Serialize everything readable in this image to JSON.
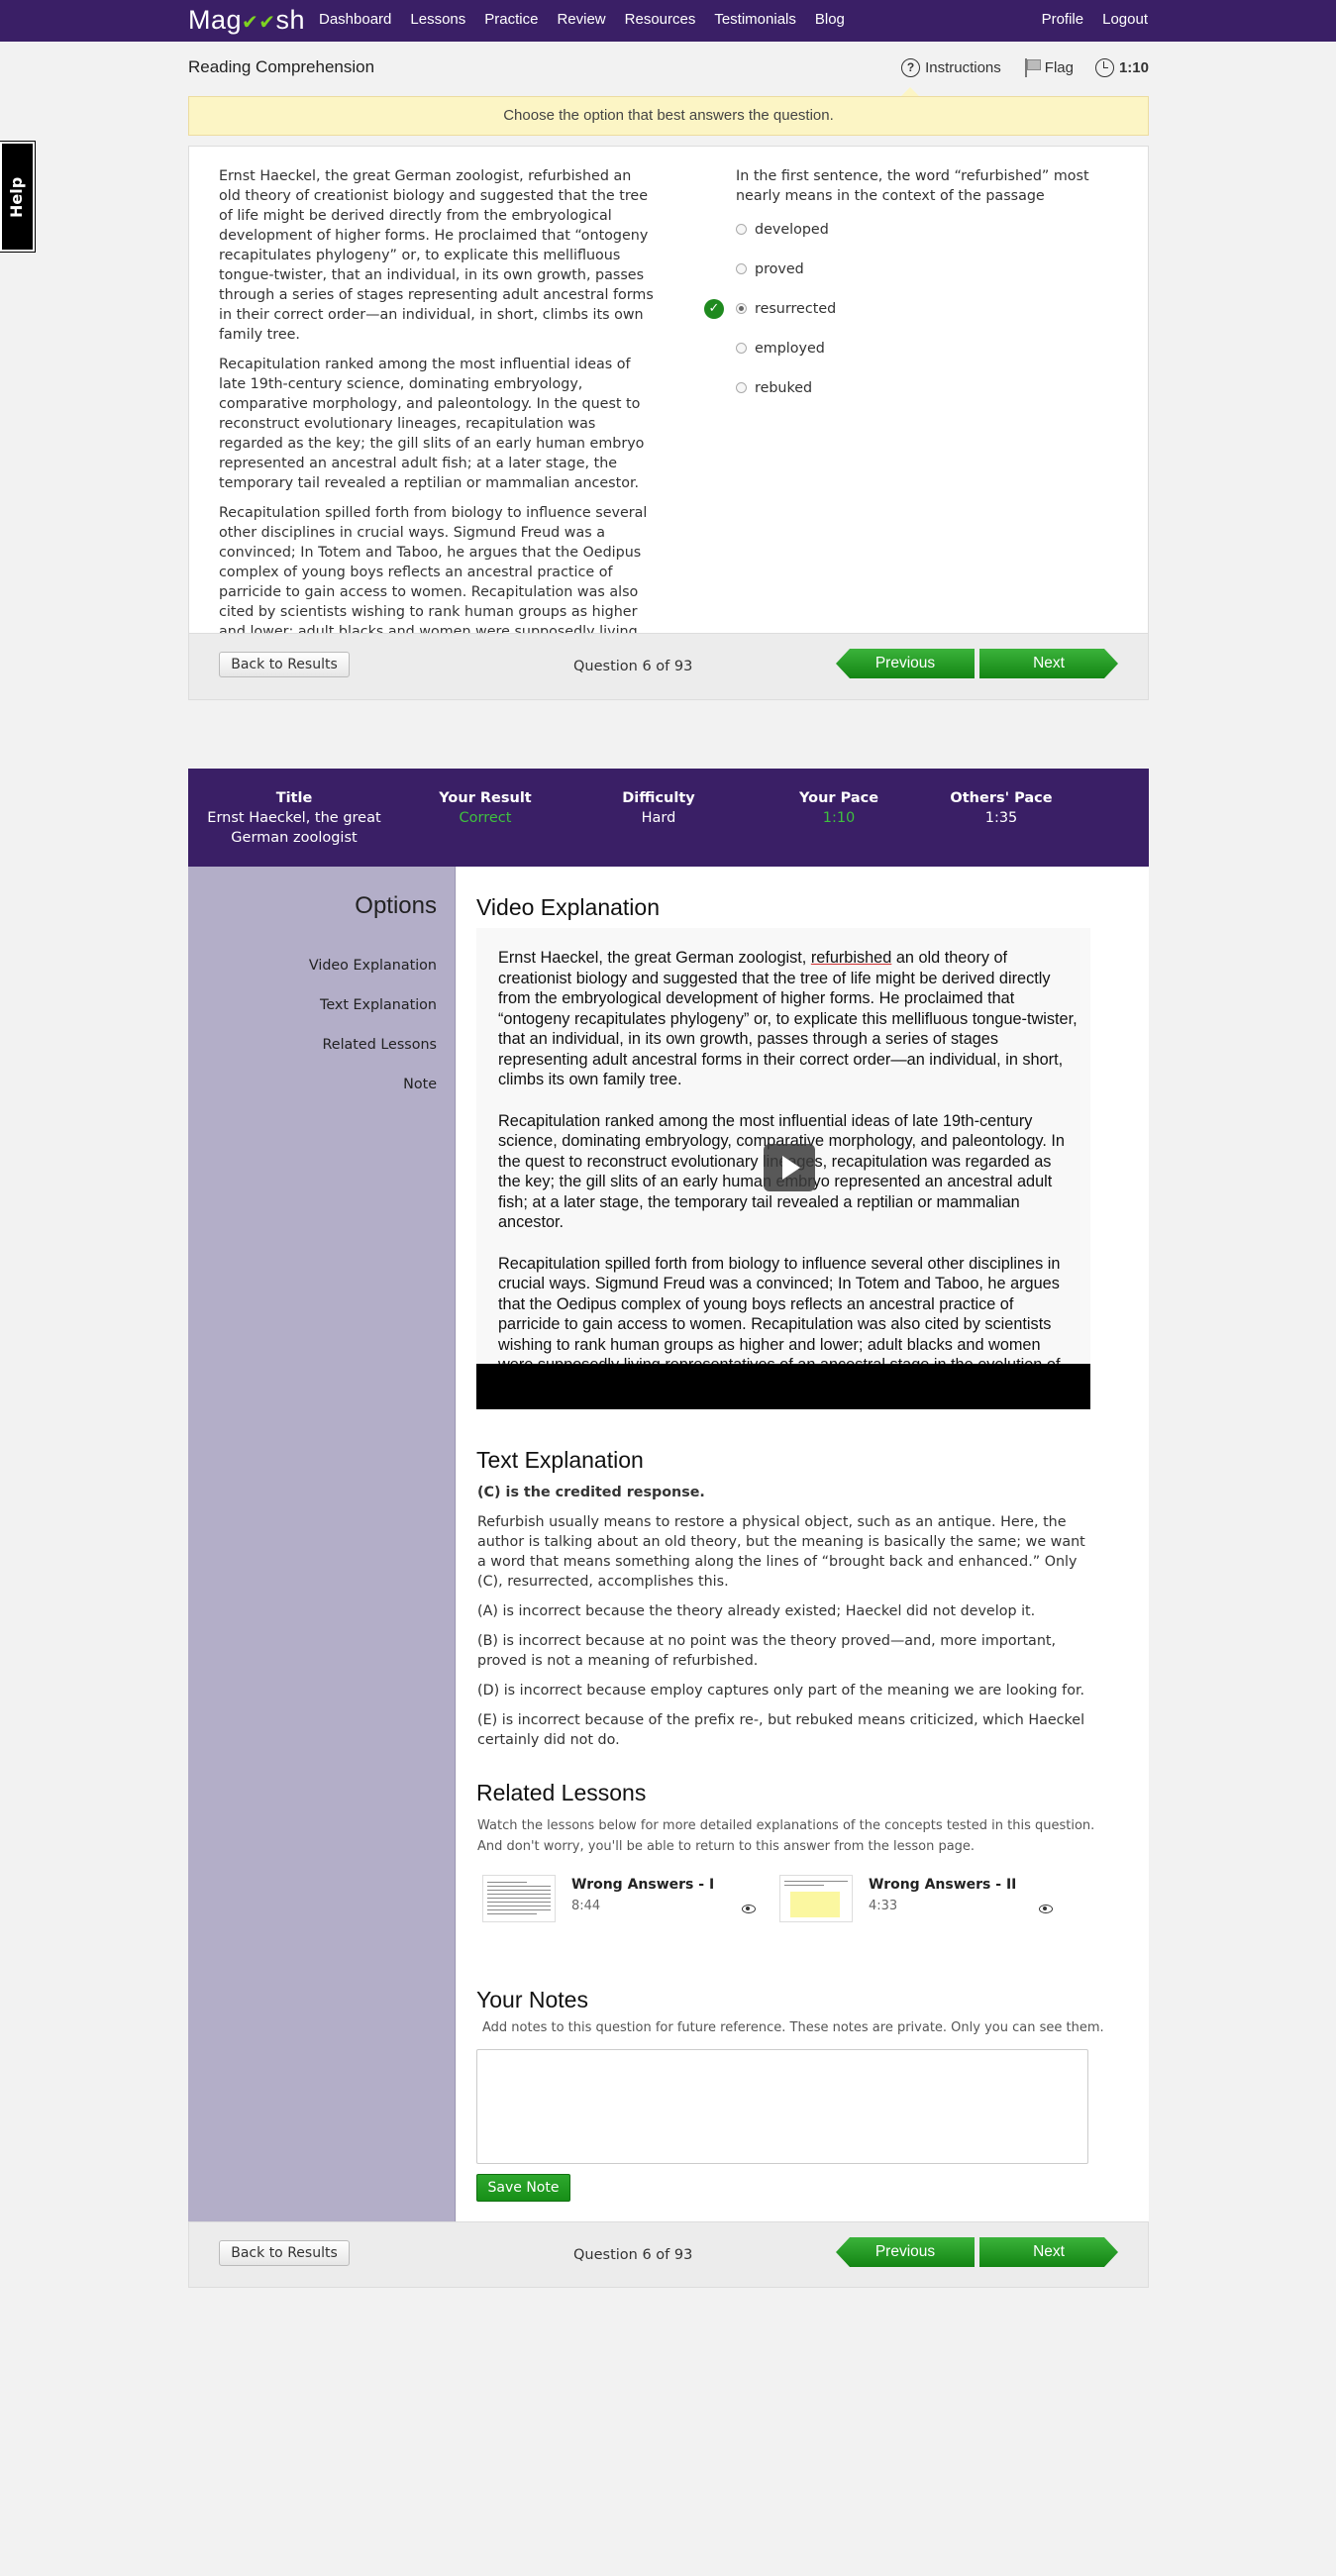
{
  "nav": {
    "logo": "Magoosh",
    "links": [
      "Dashboard",
      "Lessons",
      "Practice",
      "Review",
      "Resources",
      "Testimonials",
      "Blog"
    ],
    "right": [
      "Profile",
      "Logout"
    ],
    "icon": "checkmark-logo-icon"
  },
  "help": "Help",
  "page": {
    "title": "Reading Comprehension",
    "instructions": "Instructions",
    "flag": "Flag",
    "timer": "1:10"
  },
  "notice": "Choose the option that best answers the question.",
  "passage": [
    "Ernst Haeckel, the great German zoologist, refurbished an old theory of creationist biology and suggested that the tree of life might be derived directly from the embryological development of higher forms. He proclaimed that “ontogeny recapitulates phylogeny” or, to explicate this mellifluous tongue-twister, that an individual, in its own growth, passes through a series of stages representing adult ancestral forms in their correct order—an individual, in short, climbs its own family tree.",
    "Recapitulation ranked among the most influential ideas of late 19th-century science, dominating embryology, comparative morphology, and paleontology. In the quest to reconstruct evolutionary lineages, recapitulation was regarded as the key; the gill slits of an early human embryo represented an ancestral adult fish; at a later stage, the temporary tail revealed a reptilian or mammalian ancestor.",
    "Recapitulation spilled forth from biology to influence several other disciplines in crucial ways. Sigmund Freud was a convinced; In Totem and Taboo, he argues that the Oedipus complex of young boys reflects an ancestral practice of parricide to gain access to women. Recapitulation was also cited by scientists wishing to rank human groups as higher and lower; adult blacks and women were supposedly living representatives of an ancestral stage in the evolution of white males."
  ],
  "question": {
    "prompt": "In the first sentence, the word “refurbished” most nearly means in the context of the passage",
    "options": [
      "developed",
      "proved",
      "resurrected",
      "employed",
      "rebuked"
    ],
    "selected_index": 2,
    "correct_index": 2
  },
  "footer": {
    "back": "Back to Results",
    "count": "Question 6 of 93",
    "previous": "Previous",
    "next": "Next"
  },
  "stats": [
    {
      "label": "Title",
      "value": "Ernst Haeckel, the great German zoologist",
      "color": "#ffffff"
    },
    {
      "label": "Your Result",
      "value": "Correct",
      "color": "#3fbf3f"
    },
    {
      "label": "Difficulty",
      "value": "Hard",
      "color": "#ffffff"
    },
    {
      "label": "Your Pace",
      "value": "1:10",
      "color": "#3fbf3f"
    },
    {
      "label": "Others' Pace",
      "value": "1:35",
      "color": "#ffffff"
    }
  ],
  "sidebar": {
    "heading": "Options",
    "links": [
      "Video Explanation",
      "Text Explanation",
      "Related Lessons",
      "Note"
    ]
  },
  "video": {
    "heading": "Video Explanation",
    "p1_pre": "Ernst Haeckel, the great German zoologist, ",
    "p1_word": "refurbished",
    "p1_post": " an old theory of creationist biology and suggested that the tree of life might be derived directly from the embryological development of higher forms. He proclaimed that “ontogeny recapitulates phylogeny” or, to explicate this mellifluous tongue-twister, that an individual, in its own growth, passes through a series of stages representing adult ancestral forms in their correct order—an individual, in short, climbs its own family tree.",
    "p2": "Recapitulation ranked among the most influential ideas of late 19th-century science, dominating embryology, comparative morphology, and paleontology. In the quest to reconstruct evolutionary lineages, recapitulation was regarded as the key; the gill slits of an early human embryo represented an ancestral adult fish; at a later stage, the temporary tail revealed a reptilian or mammalian ancestor.",
    "p3": "Recapitulation spilled forth from biology to influence several other disciplines in crucial ways. Sigmund Freud was a convinced; In Totem and Taboo, he argues that the Oedipus complex of young boys reflects an ancestral practice of parricide to gain access to women. Recapitulation was also cited by scientists wishing to rank human groups as higher and lower; adult blacks and women were supposedly living representatives of an ancestral stage in the evolution of"
  },
  "text_explanation": {
    "heading": "Text Explanation",
    "credited": "(C) is the credited response.",
    "paragraphs": [
      "Refurbish usually means to restore a physical object, such as an antique. Here, the author is talking about an old theory, but the meaning is basically the same; we want a word that means something along the lines of “brought back and enhanced.” Only (C), resurrected, accomplishes this.",
      "(A) is incorrect because the theory already existed; Haeckel did not develop it.",
      "(B) is incorrect because at no point was the theory proved—and, more important, proved is not a meaning of refurbished.",
      "(D) is incorrect because employ captures only part of the meaning we are looking for.",
      "(E) is incorrect because of the prefix re-, but rebuked means criticized, which Haeckel certainly did not do."
    ]
  },
  "related": {
    "heading": "Related Lessons",
    "description": "Watch the lessons below for more detailed explanations of the concepts tested in this question. And don't worry, you'll be able to return to this answer from the lesson page.",
    "lessons": [
      {
        "title": "Wrong Answers - I",
        "duration": "8:44"
      },
      {
        "title": "Wrong Answers - II",
        "duration": "4:33"
      }
    ]
  },
  "notes": {
    "heading": "Your Notes",
    "description": "Add notes to this question for future reference. These notes are private. Only you can see them.",
    "value": "",
    "save": "Save Note"
  }
}
